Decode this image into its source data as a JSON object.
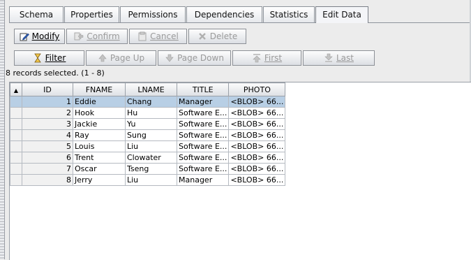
{
  "tabs": [
    {
      "label": "Schema"
    },
    {
      "label": "Properties"
    },
    {
      "label": "Permissions"
    },
    {
      "label": "Dependencies"
    },
    {
      "label": "Statistics"
    },
    {
      "label": "Edit Data",
      "active": true
    }
  ],
  "toolbar1": {
    "modify": "Modify",
    "confirm": "Confirm",
    "cancel": "Cancel",
    "delete": "Delete"
  },
  "toolbar2": {
    "filter": "Filter",
    "page_up": "Page Up",
    "page_down": "Page Down",
    "first": "First",
    "last": "Last"
  },
  "status_text": "8 records selected. (1 - 8)",
  "grid": {
    "sort_indicator": "▲",
    "columns": [
      "ID",
      "FNAME",
      "LNAME",
      "TITLE",
      "PHOTO"
    ],
    "rows": [
      {
        "id": "1",
        "fname": "Eddie",
        "lname": "Chang",
        "title": "Manager",
        "photo": "<BLOB> 66..."
      },
      {
        "id": "2",
        "fname": "Hook",
        "lname": "Hu",
        "title": "Software E...",
        "photo": "<BLOB> 66..."
      },
      {
        "id": "3",
        "fname": "Jackie",
        "lname": "Yu",
        "title": "Software E...",
        "photo": "<BLOB> 66..."
      },
      {
        "id": "4",
        "fname": "Ray",
        "lname": "Sung",
        "title": "Software E...",
        "photo": "<BLOB> 66..."
      },
      {
        "id": "5",
        "fname": "Louis",
        "lname": "Liu",
        "title": "Software E...",
        "photo": "<BLOB> 66..."
      },
      {
        "id": "6",
        "fname": "Trent",
        "lname": "Clowater",
        "title": "Software E...",
        "photo": "<BLOB> 66..."
      },
      {
        "id": "7",
        "fname": "Oscar",
        "lname": "Tseng",
        "title": "Software E...",
        "photo": "<BLOB> 66..."
      },
      {
        "id": "8",
        "fname": "Jerry",
        "lname": "Liu",
        "title": "Manager",
        "photo": "<BLOB> 66..."
      }
    ]
  },
  "colors": {
    "selection": "#b8cfe5",
    "accent": "#3a6fb0"
  }
}
